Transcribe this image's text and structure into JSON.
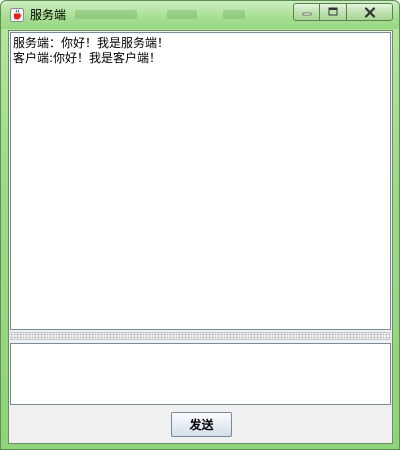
{
  "window": {
    "title": "服务端",
    "icon": "java-cup-icon",
    "controls": {
      "minimize_icon": "minimize-icon",
      "maximize_icon": "maximize-icon",
      "close_icon": "close-icon"
    }
  },
  "chat": {
    "messages": [
      "服务端：你好！我是服务端！",
      "客户端:你好！我是客户端！"
    ]
  },
  "input": {
    "value": ""
  },
  "actions": {
    "send_label": "发送"
  },
  "colors": {
    "titlebar": "#a9df95",
    "frame_border": "#5f8f52",
    "client_bg": "#f0f0f0"
  }
}
